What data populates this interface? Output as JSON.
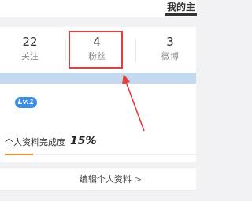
{
  "header": {
    "tab_label": "我的主"
  },
  "stats": [
    {
      "count": "22",
      "label": "关注"
    },
    {
      "count": "4",
      "label": "粉丝"
    },
    {
      "count": "3",
      "label": "微博"
    }
  ],
  "profile": {
    "level_badge": "Lv.1",
    "completeness_label": "个人资料完成度",
    "completeness_value": "15%",
    "completeness_fraction": 0.15,
    "edit_label": "编辑个人资料",
    "edit_chevron": ">"
  },
  "colors": {
    "highlight": "#e63c3c",
    "progress": "#f28a2e",
    "level_badge": "#3a8ee6",
    "band": "#c2d9ef"
  }
}
